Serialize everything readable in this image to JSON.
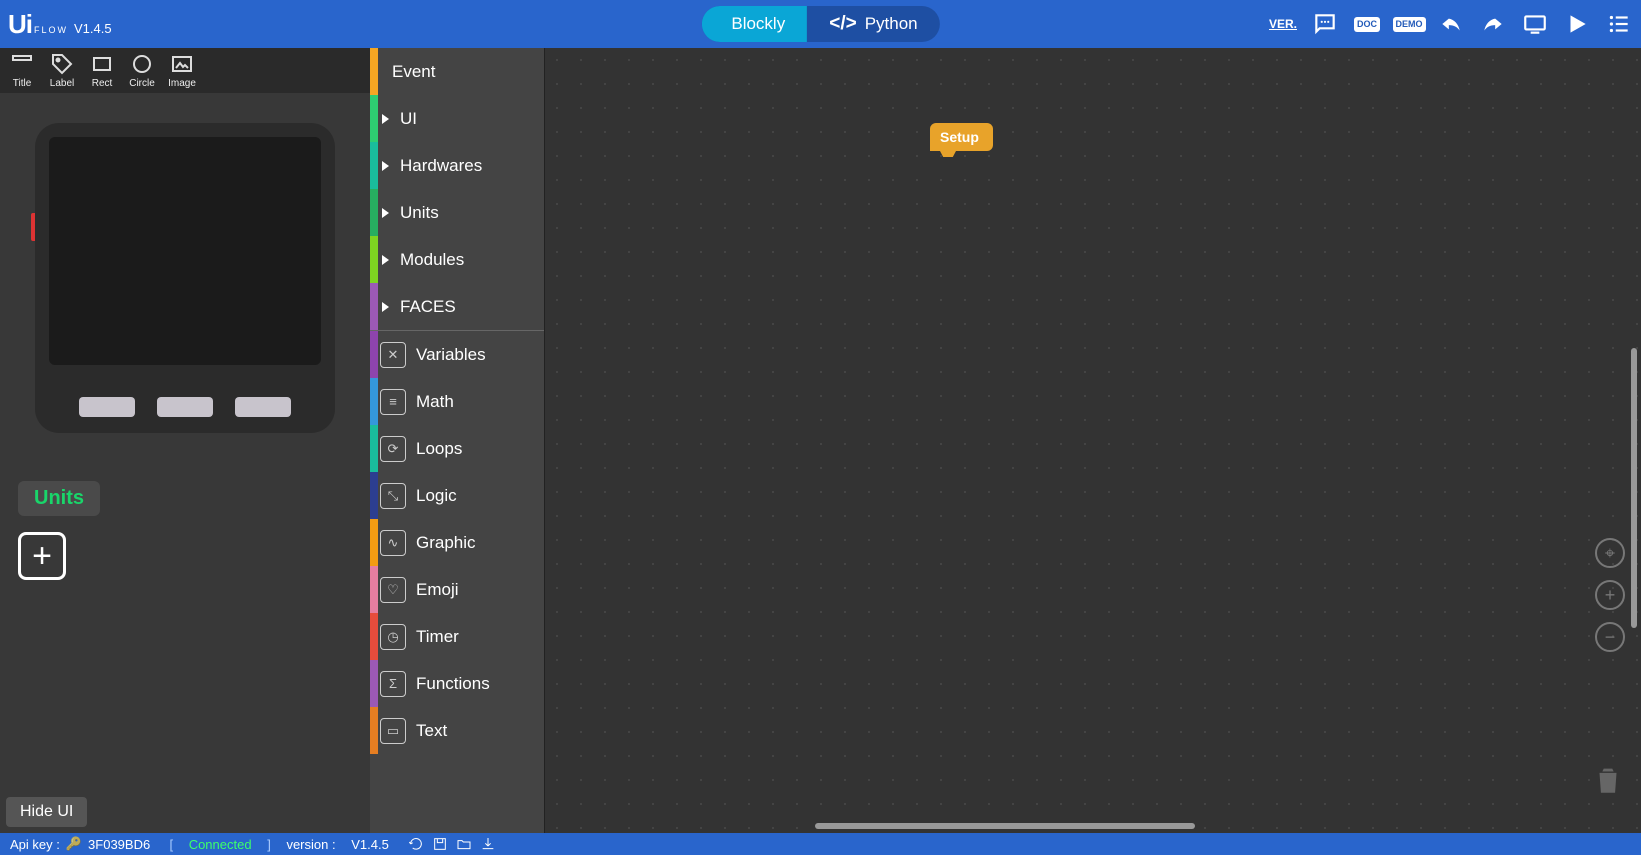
{
  "app": {
    "logo_main": "Ui",
    "logo_sub": "FLOW",
    "version": "V1.4.5"
  },
  "tabs": {
    "blockly": "Blockly",
    "python": "Python"
  },
  "top_icons": {
    "ver": "VER.",
    "doc": "DOC",
    "demo": "DEMO"
  },
  "tools": [
    {
      "id": "title",
      "label": "Title"
    },
    {
      "id": "label",
      "label": "Label"
    },
    {
      "id": "rect",
      "label": "Rect"
    },
    {
      "id": "circle",
      "label": "Circle"
    },
    {
      "id": "image",
      "label": "Image"
    }
  ],
  "units_label": "Units",
  "hide_ui": "Hide UI",
  "toolbox_top": [
    {
      "label": "Event",
      "color": "#f5a623",
      "arrow": false
    },
    {
      "label": "UI",
      "color": "#2ecc71",
      "arrow": true
    },
    {
      "label": "Hardwares",
      "color": "#1abc9c",
      "arrow": true
    },
    {
      "label": "Units",
      "color": "#27ae60",
      "arrow": true
    },
    {
      "label": "Modules",
      "color": "#7ed321",
      "arrow": true
    },
    {
      "label": "FACES",
      "color": "#9b59b6",
      "arrow": true
    }
  ],
  "toolbox_bottom": [
    {
      "label": "Variables",
      "color": "#8e44ad",
      "glyph": "✕"
    },
    {
      "label": "Math",
      "color": "#3498db",
      "glyph": "≡"
    },
    {
      "label": "Loops",
      "color": "#1abc9c",
      "glyph": "⟳"
    },
    {
      "label": "Logic",
      "color": "#2c3e90",
      "glyph": "⤡"
    },
    {
      "label": "Graphic",
      "color": "#f39c12",
      "glyph": "∿"
    },
    {
      "label": "Emoji",
      "color": "#e67ea0",
      "glyph": "♡"
    },
    {
      "label": "Timer",
      "color": "#e74c3c",
      "glyph": "◷"
    },
    {
      "label": "Functions",
      "color": "#9b59b6",
      "glyph": "Σ"
    },
    {
      "label": "Text",
      "color": "#e67e22",
      "glyph": "▭"
    }
  ],
  "workspace": {
    "setup_block": "Setup"
  },
  "status": {
    "api_key_label": "Api key :",
    "api_key": "3F039BD6",
    "connected": "Connected",
    "version_label": "version :",
    "version": "V1.4.5"
  }
}
